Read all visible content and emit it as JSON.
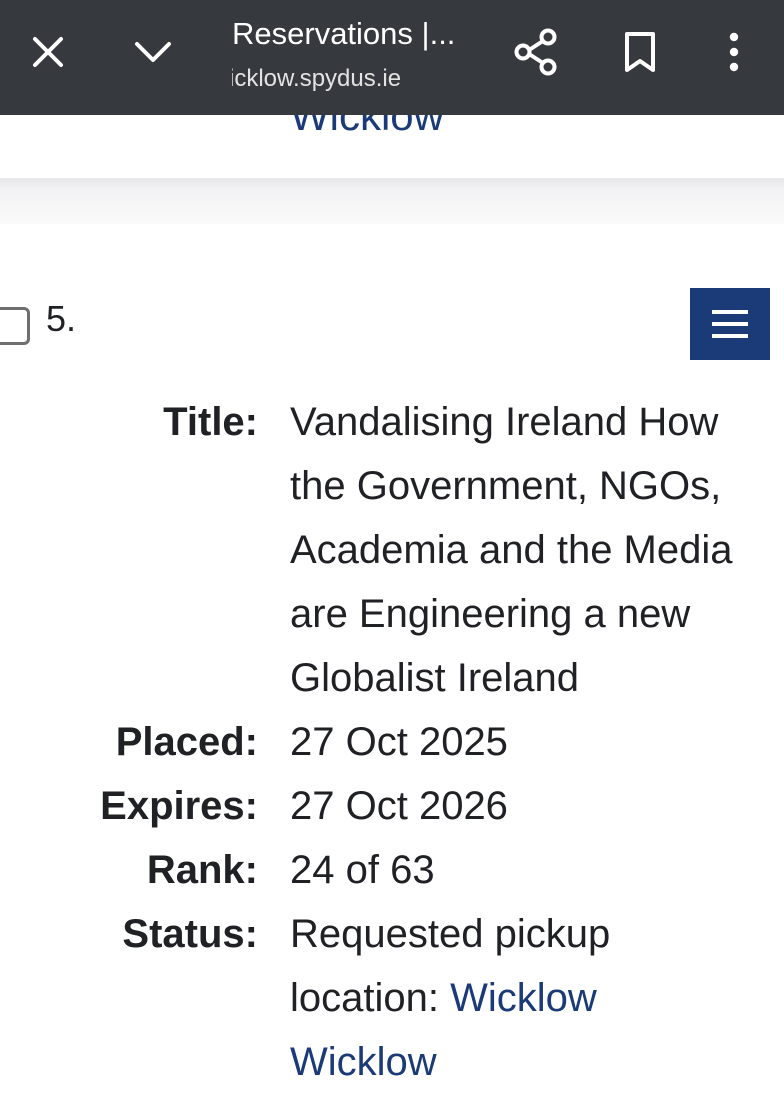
{
  "toolbar": {
    "title": "Reservations |...",
    "url": "icklow.spydus.ie",
    "icons": {
      "close": "close-icon",
      "minimize": "chevron-down-icon",
      "share": "share-icon",
      "bookmark": "bookmark-icon",
      "more": "more-vert-icon"
    }
  },
  "previous_item": {
    "pickup_link": "Wicklow"
  },
  "item": {
    "number": "5.",
    "menu_icon": "hamburger-menu-icon",
    "fields": {
      "title_label": "Title:",
      "title_value": "Vandalising Ireland How the Government, NGOs, Academia and the Media are Engineering a new Globalist Ireland",
      "placed_label": "Placed:",
      "placed_value": "27 Oct 2025",
      "expires_label": "Expires:",
      "expires_value": "27 Oct 2026",
      "rank_label": "Rank:",
      "rank_value": "24 of 63",
      "status_label": "Status:",
      "status_text": "Requested pickup location: ",
      "status_link": "Wicklow Wicklow"
    }
  },
  "colors": {
    "toolbar_bg": "#36393d",
    "link": "#1b3a78",
    "menu_button": "#1b3a78",
    "text": "#202124"
  }
}
